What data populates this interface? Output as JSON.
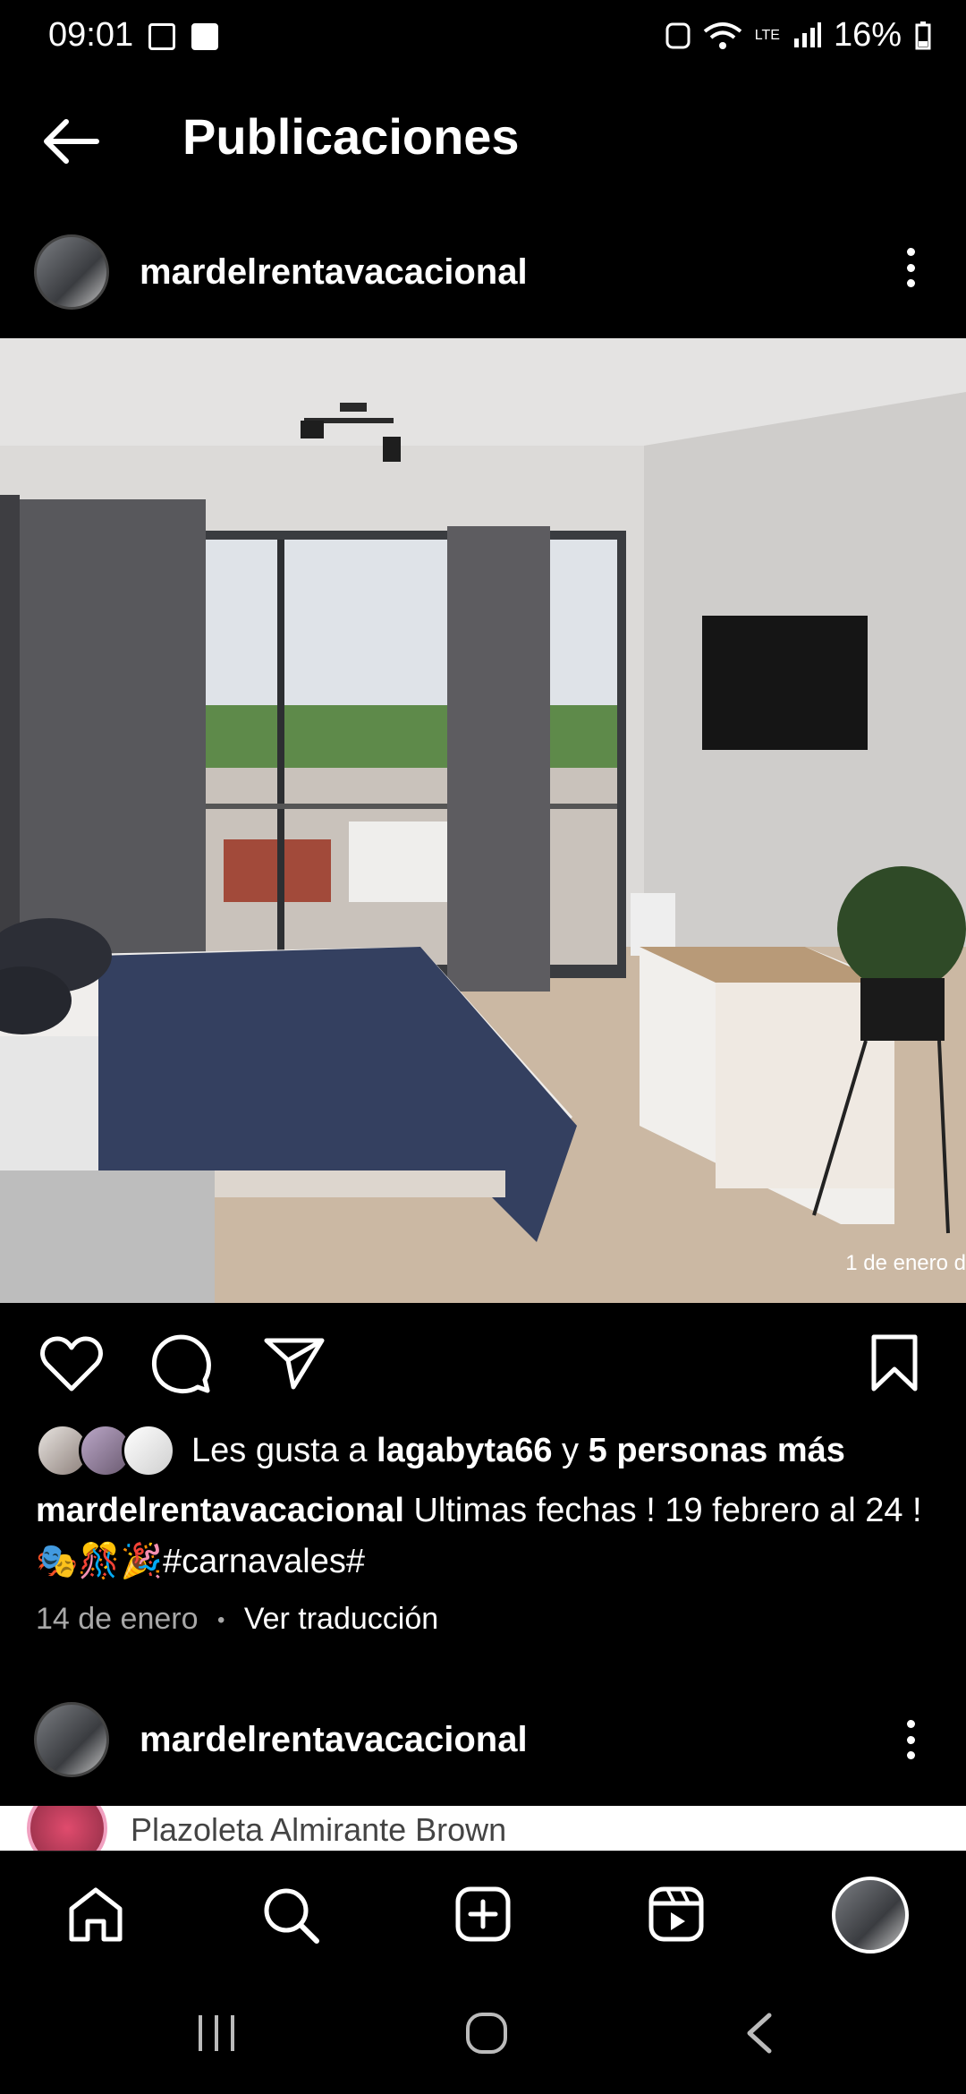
{
  "status": {
    "time": "09:01",
    "battery": "16%",
    "network": "LTE"
  },
  "header": {
    "title": "Publicaciones"
  },
  "post": {
    "username": "mardelrentavacacional",
    "photo_date": "1 de enero d",
    "likes": {
      "prefix": "Les gusta a ",
      "user": "lagabyta66",
      "joiner": " y ",
      "others": "5 personas más"
    },
    "caption": {
      "user": "mardelrentavacacional",
      "text": " Ultimas fechas ! 19 febrero al 24 ! 🎭🎊🎉#carnavales#"
    },
    "date": "14 de enero",
    "separator": "•",
    "translate": "Ver traducción"
  },
  "next_post": {
    "username": "mardelrentavacacional",
    "peek_location": "Plazoleta Almirante Brown"
  },
  "icons": {
    "back": "arrow-left-icon",
    "more": "more-vertical-icon",
    "like": "heart-icon",
    "comment": "comment-icon",
    "share": "send-icon",
    "save": "bookmark-icon",
    "home": "home-icon",
    "search": "search-icon",
    "create": "plus-square-icon",
    "reels": "reels-icon"
  },
  "colors": {
    "background": "#000000",
    "text": "#ffffff",
    "muted": "#a8a8a8"
  }
}
